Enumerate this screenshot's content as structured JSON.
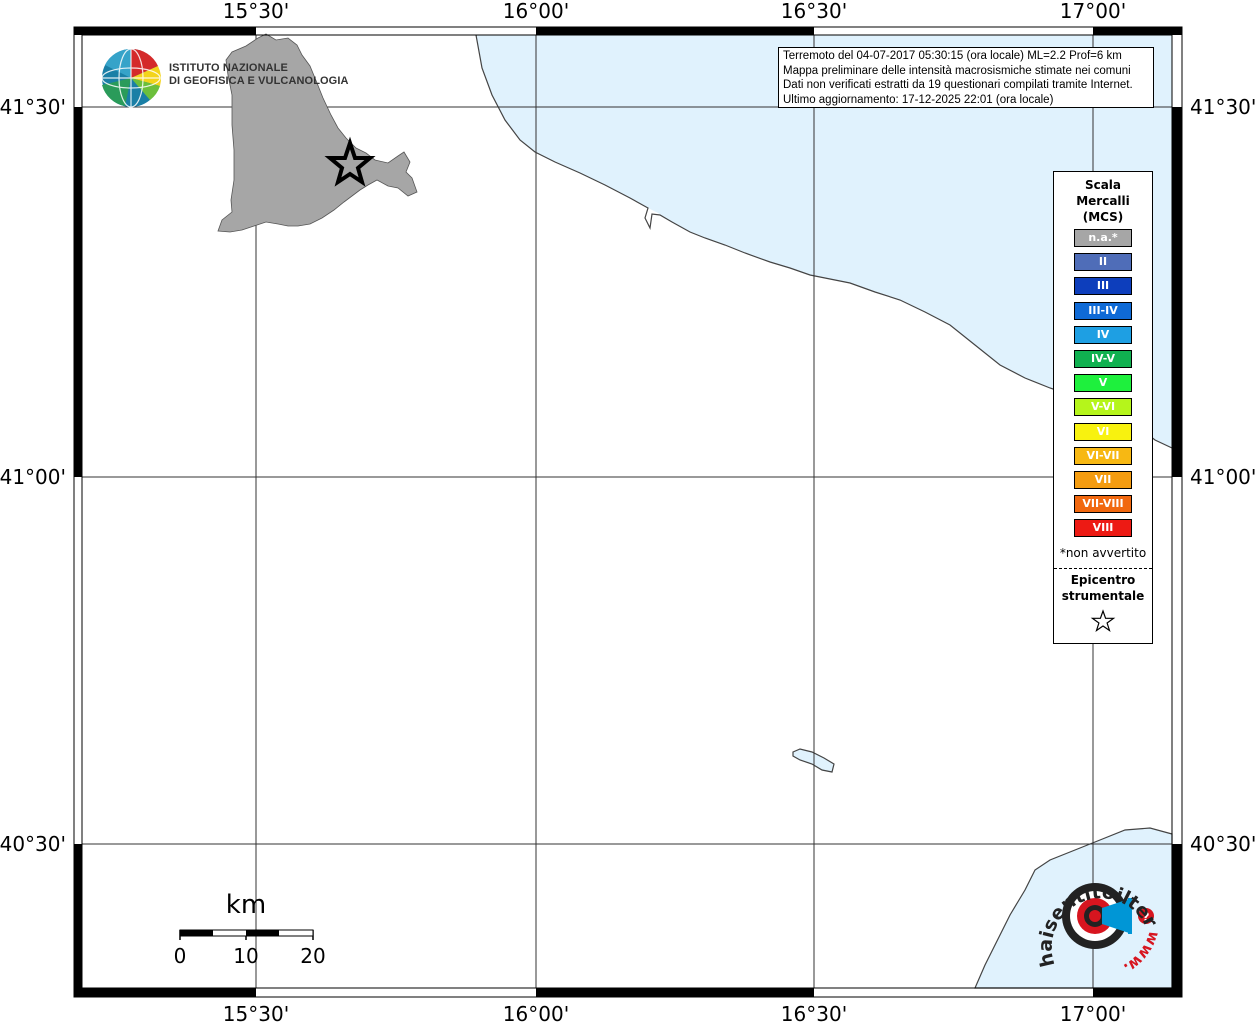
{
  "map": {
    "lon_labels": [
      "15°30'",
      "16°00'",
      "16°30'",
      "17°00'"
    ],
    "lat_labels": [
      "41°30'",
      "41°00'",
      "40°30'"
    ],
    "colors": {
      "sea": "#e0f2fd",
      "province": "#a6a6a6",
      "frame": "#000000"
    }
  },
  "logo": {
    "line1": "ISTITUTO NAZIONALE",
    "line2": "DI GEOFISICA E VULCANOLOGIA",
    "icon": "ingv-globe-icon"
  },
  "info": {
    "line1": "Terremoto del 04-07-2017 05:30:15 (ora locale) ML=2.2 Prof=6 km",
    "line2": "Mappa preliminare delle intensità macrosismiche stimate nei comuni",
    "line3": "Dati non verificati estratti da 19 questionari compilati tramite Internet.",
    "line4": "Ultimo aggiornamento: 17-12-2025 22:01 (ora locale)"
  },
  "legend": {
    "title1": "Scala",
    "title2": "Mercalli",
    "title3": "(MCS)",
    "items": [
      {
        "label": "n.a.*",
        "color": "#a6a6a6"
      },
      {
        "label": "II",
        "color": "#4f6db8"
      },
      {
        "label": "III",
        "color": "#0d3ebc"
      },
      {
        "label": "III-IV",
        "color": "#0f6ad6"
      },
      {
        "label": "IV",
        "color": "#1e9fe3"
      },
      {
        "label": "IV-V",
        "color": "#10b150"
      },
      {
        "label": "V",
        "color": "#1ef03d"
      },
      {
        "label": "V-VI",
        "color": "#b5f51b"
      },
      {
        "label": "VI",
        "color": "#f8f20f"
      },
      {
        "label": "VI-VII",
        "color": "#f7b813"
      },
      {
        "label": "VII",
        "color": "#f49c10"
      },
      {
        "label": "VII-VIII",
        "color": "#f1680f"
      },
      {
        "label": "VIII",
        "color": "#ed1a14"
      }
    ],
    "note": "*non avvertito",
    "epicentre_line1": "Epicentro",
    "epicentre_line2": "strumentale",
    "epicentre_icon": "star-icon"
  },
  "scalebar": {
    "unit": "km",
    "ticks": [
      "0",
      "10",
      "20"
    ]
  },
  "watermark": {
    "text": "haisentitoilterremoto.it",
    "prefix": "www.",
    "icon": "hsit-target-logo-icon",
    "colors": {
      "red": "#d7151f",
      "dark": "#222222",
      "blue": "#0096d6"
    }
  }
}
